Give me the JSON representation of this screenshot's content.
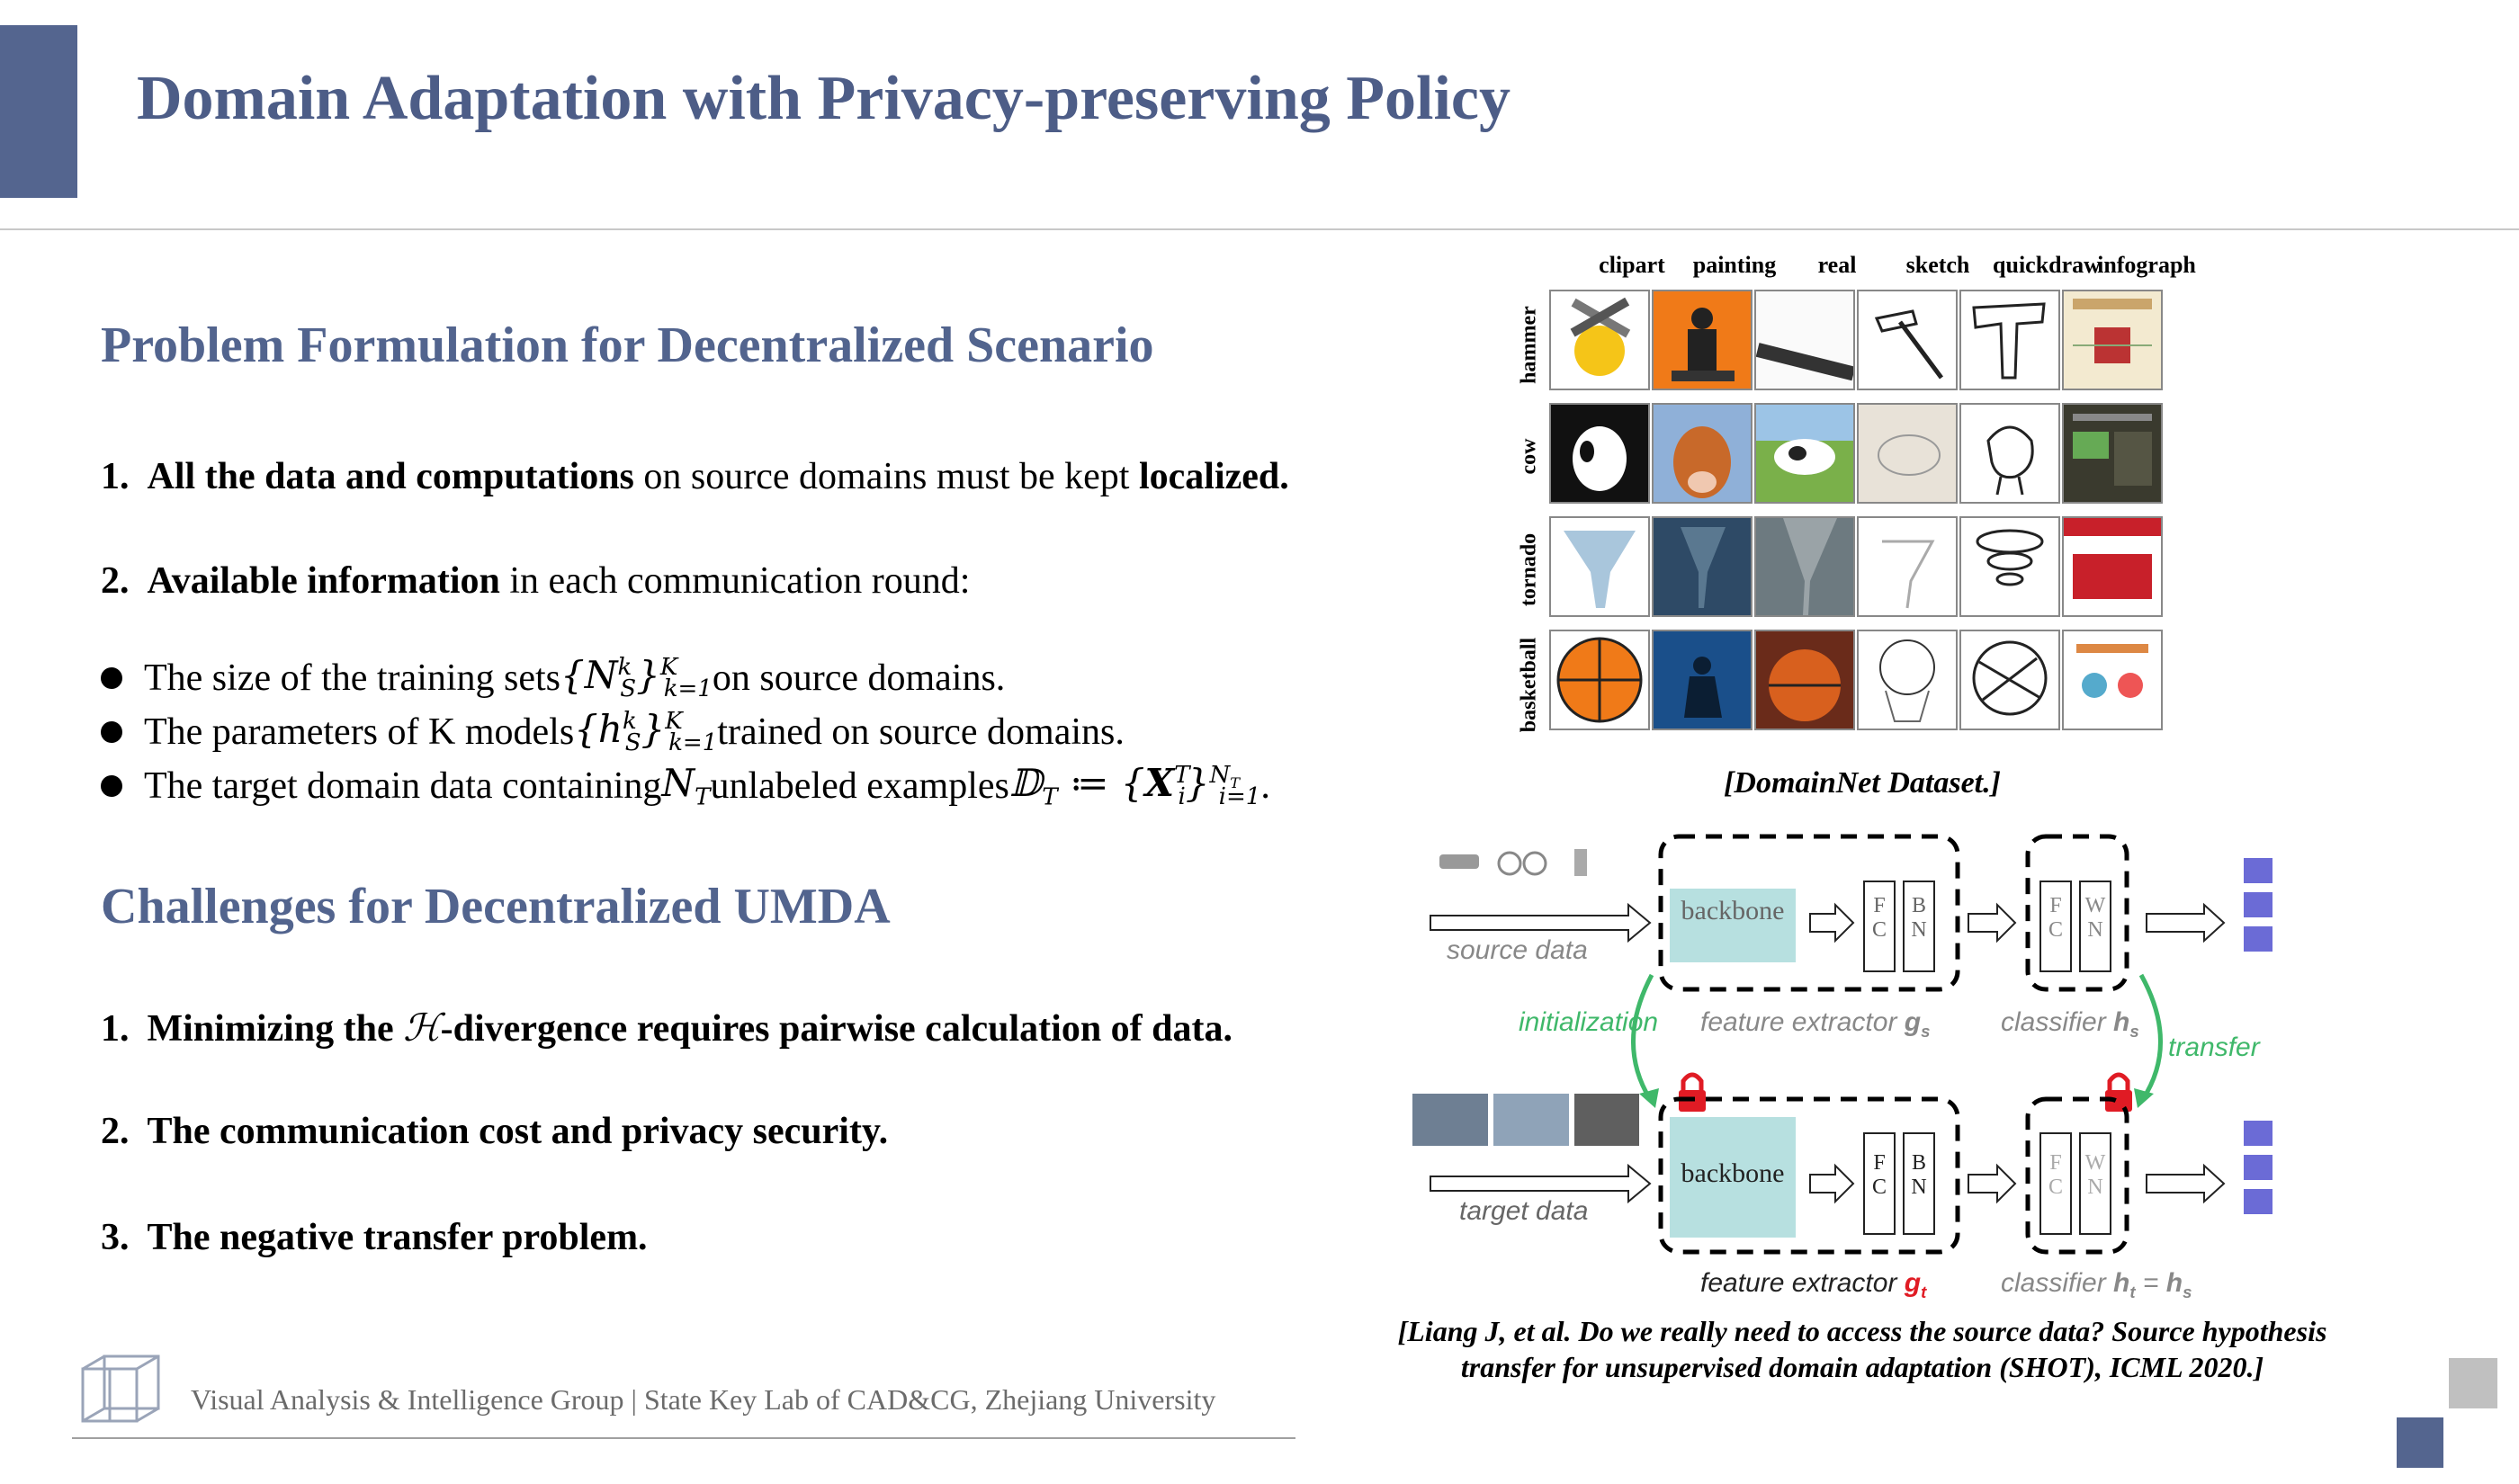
{
  "title": "Domain Adaptation with Privacy-preserving Policy",
  "section1": {
    "heading": "Problem Formulation for Decentralized Scenario",
    "item1": {
      "num": "1.",
      "b1": "All  the data and computations",
      "t1": " on  source domains must be kept ",
      "b2": "localized."
    },
    "item2": {
      "num": "2.",
      "b1": "Available information",
      "t1": " in each communication round:"
    },
    "bullets": {
      "b1_pre": "The size of the training sets ",
      "b1_math": "{N",
      "b1_post": "on source domains.",
      "b2_pre": "The parameters of K  models ",
      "b2_math": "{h",
      "b2_post": " trained on source domains.",
      "b3_pre": "The target domain data containing ",
      "b3_math1": "N",
      "b3_mid": " unlabeled examples ",
      "b3_math2": "𝔻",
      "b3_math3": " ≔ {",
      "b3_post": "."
    }
  },
  "section2": {
    "heading": "Challenges for Decentralized UMDA",
    "item1": {
      "num": "1.",
      "b1": "Minimizing the ",
      "math": "ℋ",
      "b2": "-divergence requires pairwise calculation of data."
    },
    "item2": {
      "num": "2.",
      "b1": "The communication cost and privacy security."
    },
    "item3": {
      "num": "3.",
      "b1": "The negative transfer problem."
    }
  },
  "domainnet": {
    "columns": [
      "clipart",
      "painting",
      "real",
      "sketch",
      "quickdraw",
      "infograph"
    ],
    "rows": [
      "hammer",
      "cow",
      "tornado",
      "basketball"
    ],
    "caption": "[DomainNet Dataset.]"
  },
  "shot": {
    "source_data": "source data",
    "target_data": "target data",
    "backbone": "backbone",
    "fc": "F C",
    "bn": "B N",
    "wn": "W N",
    "initialization": "initialization",
    "transfer": "transfer",
    "feature_extractor": "feature extractor",
    "classifier": "classifier",
    "gs": "g",
    "gs_sub": "s",
    "gt": "g",
    "gt_sub": "t",
    "hs": "h",
    "hs_sub": "s",
    "ht_eq": "h",
    "ht_sub": "t",
    "eq": " = ",
    "hs2": "h",
    "hs2_sub": "s",
    "caption_line1": "[Liang J, et al. Do we really need to access the source data? Source hypothesis",
    "caption_line2": "transfer for unsupervised domain adaptation (SHOT), ICML 2020.]"
  },
  "footer": {
    "text": "Visual Analysis & Intelligence Group | State Key Lab of CAD&CG, Zhejiang University"
  },
  "colors": {
    "accent": "#54658f",
    "heading": "#52648e",
    "backbone": "#b7e0e0",
    "green": "#3fb86a",
    "lock": "#e01b24",
    "cube": "#6b6bd6"
  }
}
